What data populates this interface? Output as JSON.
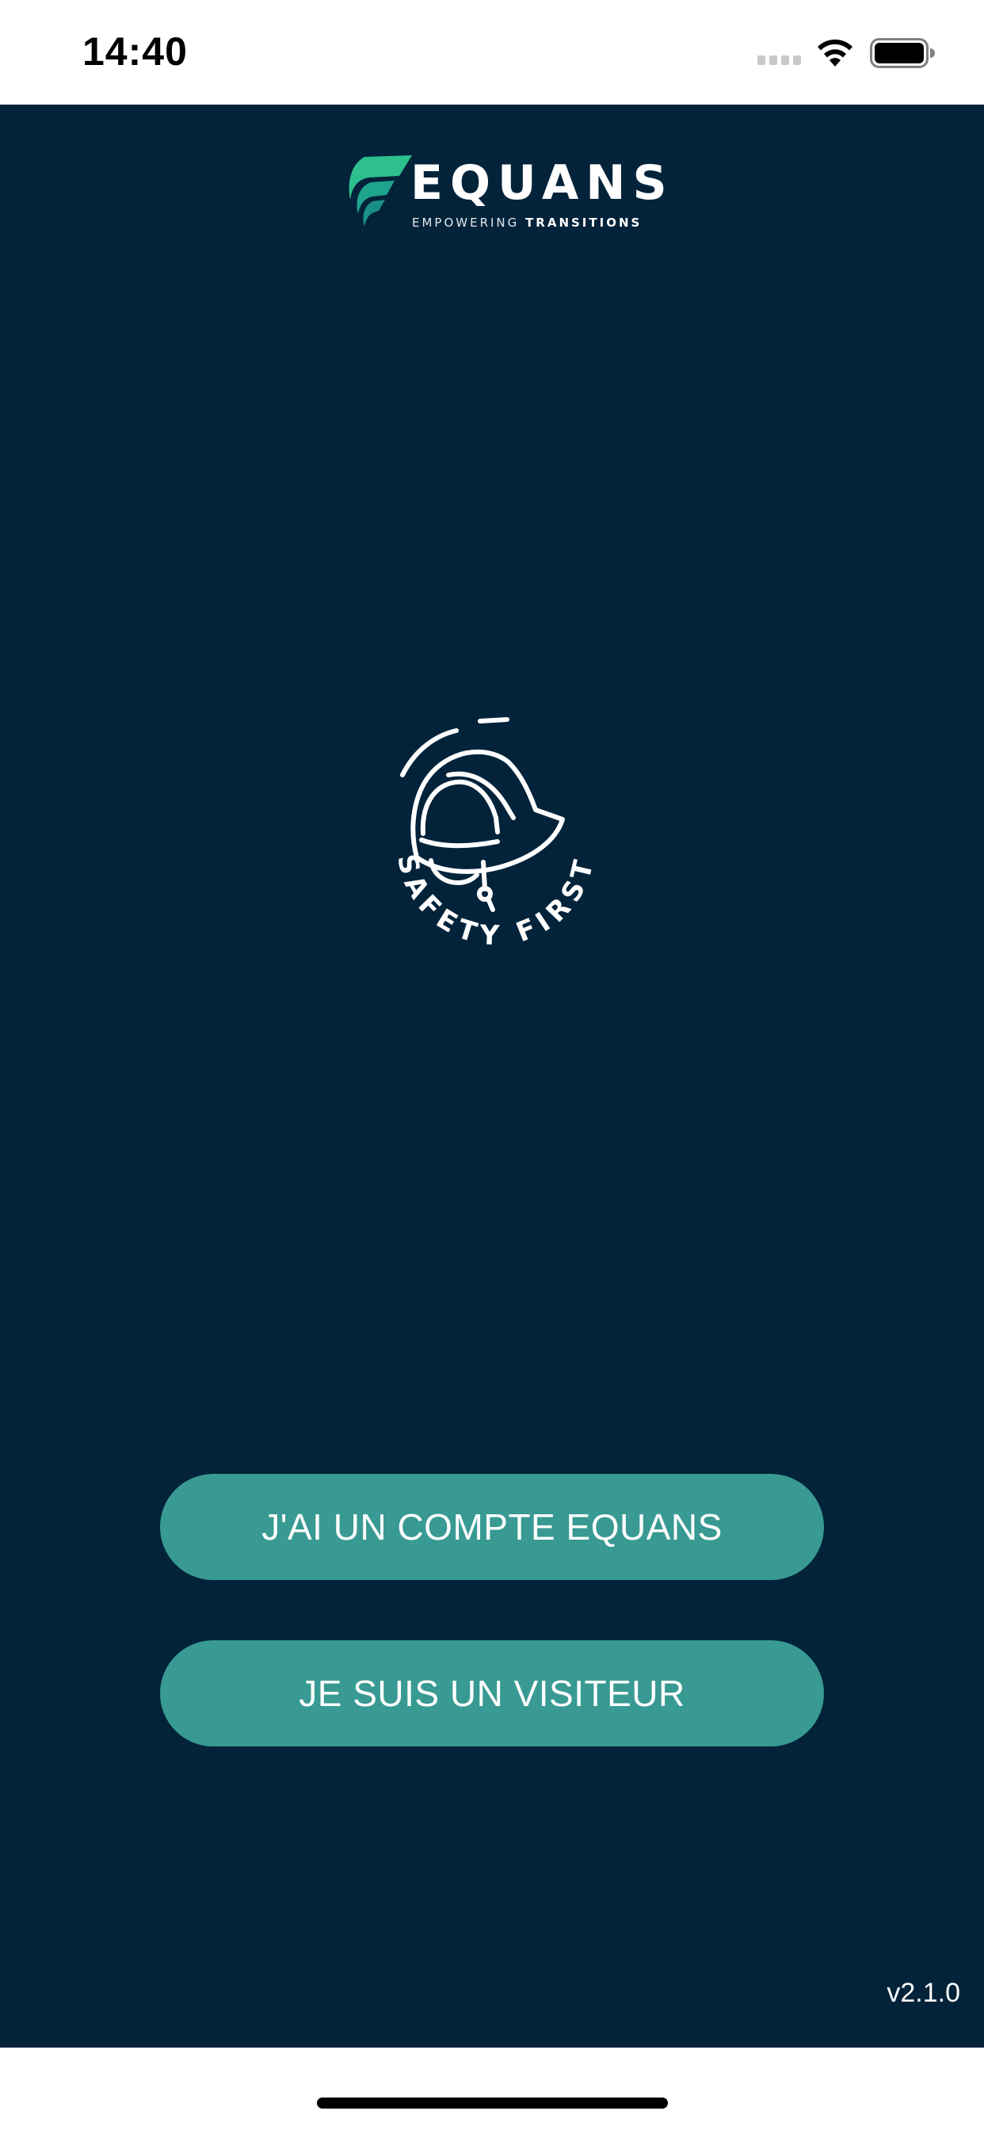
{
  "status_bar": {
    "time": "14:40",
    "icons": [
      "signal-dots-icon",
      "wifi-icon",
      "battery-icon"
    ]
  },
  "brand": {
    "name": "EQUANS",
    "tagline_light": "EMPOWERING",
    "tagline_bold": "TRANSITIONS",
    "colors": {
      "mark_primary": "#2ebf8f",
      "mark_secondary": "#1fa58d"
    }
  },
  "emblem": {
    "text": "SAFETY FIRST",
    "icon": "hard-hat-icon"
  },
  "buttons": {
    "account": "J'AI UN COMPTE EQUANS",
    "visitor": "JE SUIS UN VISITEUR"
  },
  "version": "v2.1.0",
  "colors": {
    "background": "#02233a",
    "button": "#389a92",
    "text": "#ffffff"
  }
}
